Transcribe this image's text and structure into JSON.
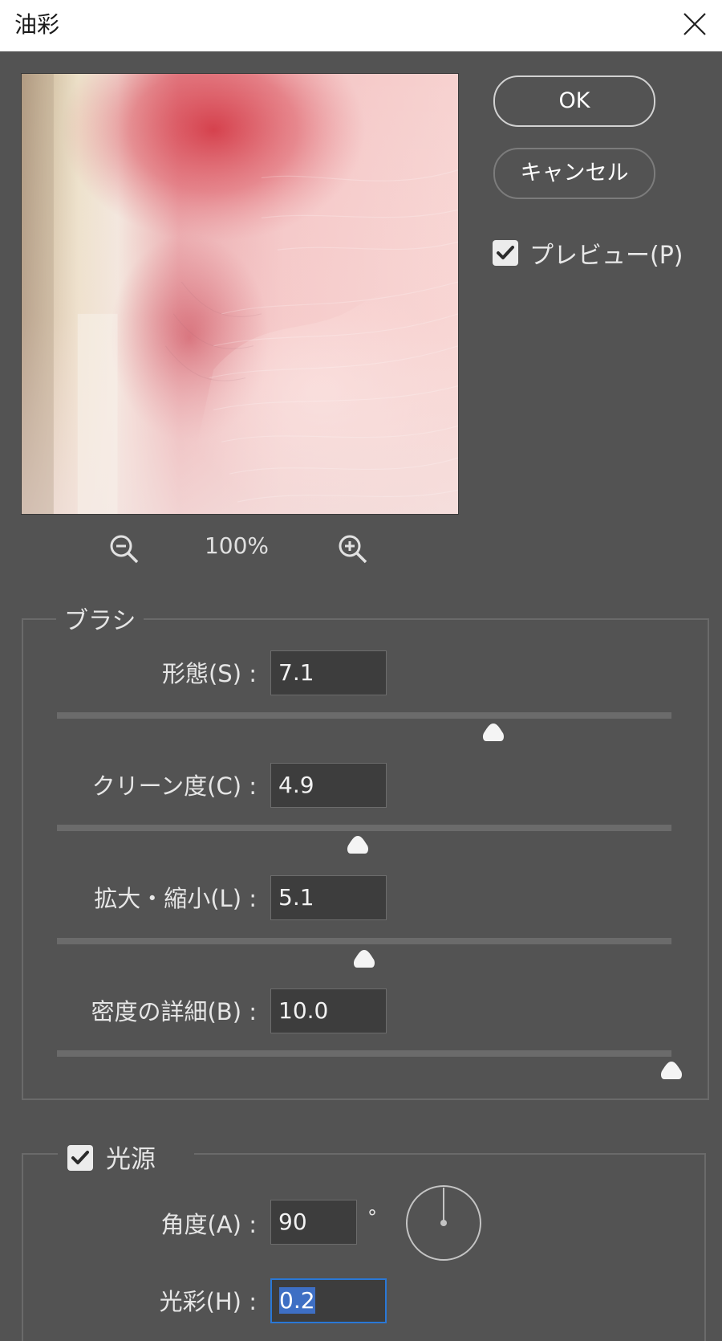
{
  "window": {
    "title": "油彩"
  },
  "preview": {
    "zoom_level": "100%"
  },
  "buttons": {
    "ok_label": "OK",
    "cancel_label": "キャンセル"
  },
  "preview_toggle": {
    "label": "プレビュー(P)",
    "checked": true
  },
  "brush": {
    "group_label": "ブラシ",
    "fields": [
      {
        "label": "形態(S) :",
        "value": "7.1",
        "min": 0.1,
        "max": 10,
        "fraction": 0.71
      },
      {
        "label": "クリーン度(C) :",
        "value": "4.9",
        "min": 0,
        "max": 10,
        "fraction": 0.49
      },
      {
        "label": "拡大・縮小(L) :",
        "value": "5.1",
        "min": 0.1,
        "max": 10,
        "fraction": 0.5
      },
      {
        "label": "密度の詳細(B) :",
        "value": "10.0",
        "min": 0,
        "max": 10,
        "fraction": 1.0
      }
    ]
  },
  "lighting": {
    "group_label": "光源",
    "checked": true,
    "angle": {
      "label": "角度(A) :",
      "value": "90",
      "unit": "°"
    },
    "shine": {
      "label": "光彩(H) :",
      "value": "0.2"
    }
  },
  "colors": {
    "dialog_bg": "#535353",
    "field_bg": "#3d3d3d",
    "focus": "#2a78d6",
    "selection": "#3e6fc4"
  },
  "icons": [
    "close-icon",
    "zoom-out-icon",
    "zoom-in-icon",
    "checkmark-icon",
    "slider-thumb-icon",
    "angle-dial-icon"
  ]
}
